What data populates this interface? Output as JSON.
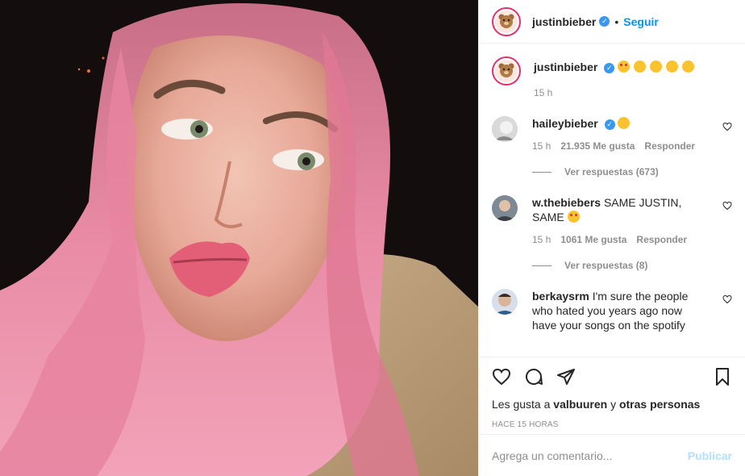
{
  "header": {
    "username": "justinbieber",
    "follow_label": "Seguir",
    "dot": "•"
  },
  "caption": {
    "username": "justinbieber",
    "emojis": [
      "heart-eyes",
      "smiling-hearts",
      "kiss",
      "smiling-blush",
      "smiling-hearts"
    ],
    "time": "15 h"
  },
  "comments": [
    {
      "username": "haileybieber",
      "text": "",
      "verified": true,
      "time": "15 h",
      "likes": "21.935 Me gusta",
      "reply": "Responder",
      "view_replies": "Ver respuestas (673)"
    },
    {
      "username": "w.thebiebers",
      "text": "SAME JUSTIN, SAME",
      "time": "15 h",
      "likes": "1061 Me gusta",
      "reply": "Responder",
      "view_replies": "Ver respuestas (8)"
    },
    {
      "username": "berkaysrm",
      "text": "I'm sure the people who hated you years ago now have your songs on the spotify"
    }
  ],
  "likes": {
    "prefix": "Les gusta a ",
    "user": "valbuuren",
    "conj": " y ",
    "others": "otras personas"
  },
  "timestamp": "HACE 15 HORAS",
  "add_comment": {
    "placeholder": "Agrega un comentario...",
    "post_label": "Publicar"
  },
  "colors": {
    "accent": "#0095f6",
    "verified": "#3897f0",
    "muted": "#8e8e8e"
  }
}
